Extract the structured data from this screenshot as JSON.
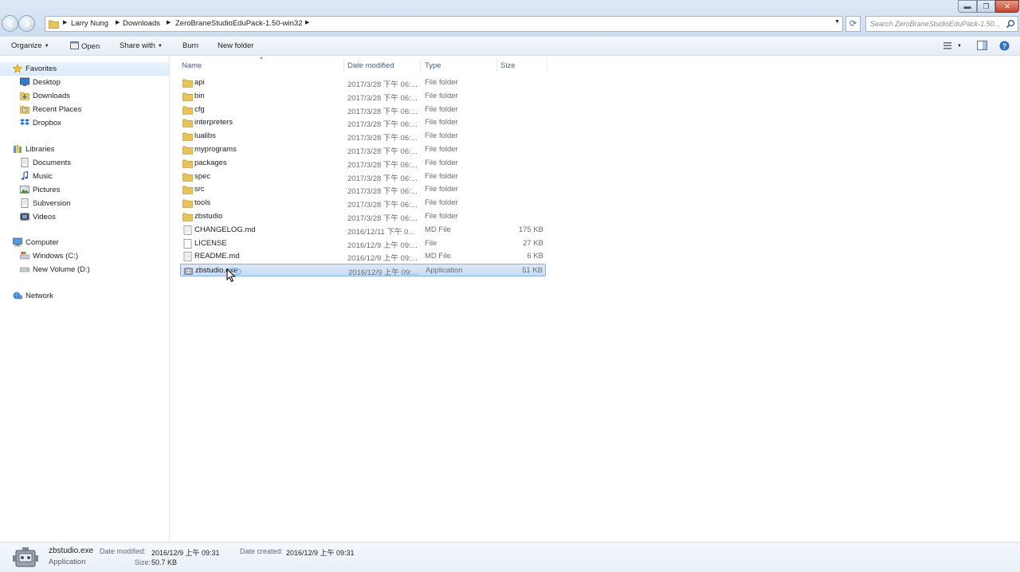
{
  "window": {
    "minimize_glyph": "▬",
    "maximize_glyph": "❐",
    "close_glyph": "✕"
  },
  "address": {
    "breadcrumbs": [
      "Larry Nung",
      "Downloads",
      "ZeroBraneStudioEduPack-1.50-win32"
    ],
    "search_placeholder": "Search ZeroBraneStudioEduPack-1.50..."
  },
  "toolbar": {
    "organize": "Organize",
    "open": "Open",
    "share_with": "Share with",
    "burn": "Burn",
    "new_folder": "New folder"
  },
  "nav": {
    "favorites": {
      "label": "Favorites",
      "items": [
        "Desktop",
        "Downloads",
        "Recent Places",
        "Dropbox"
      ]
    },
    "libraries": {
      "label": "Libraries",
      "items": [
        "Documents",
        "Music",
        "Pictures",
        "Subversion",
        "Videos"
      ]
    },
    "computer": {
      "label": "Computer",
      "items": [
        "Windows  (C:)",
        "New Volume (D:)"
      ]
    },
    "network": {
      "label": "Network"
    }
  },
  "columns": {
    "name": "Name",
    "date_modified": "Date modified",
    "type": "Type",
    "size": "Size"
  },
  "files": [
    {
      "name": "api",
      "date": "2017/3/28 下午 06:...",
      "type": "File folder",
      "size": "",
      "kind": "folder"
    },
    {
      "name": "bin",
      "date": "2017/3/28 下午 06:...",
      "type": "File folder",
      "size": "",
      "kind": "folder"
    },
    {
      "name": "cfg",
      "date": "2017/3/28 下午 06:...",
      "type": "File folder",
      "size": "",
      "kind": "folder"
    },
    {
      "name": "interpreters",
      "date": "2017/3/28 下午 06:...",
      "type": "File folder",
      "size": "",
      "kind": "folder"
    },
    {
      "name": "lualibs",
      "date": "2017/3/28 下午 06:...",
      "type": "File folder",
      "size": "",
      "kind": "folder"
    },
    {
      "name": "myprograms",
      "date": "2017/3/28 下午 06:...",
      "type": "File folder",
      "size": "",
      "kind": "folder"
    },
    {
      "name": "packages",
      "date": "2017/3/28 下午 06:...",
      "type": "File folder",
      "size": "",
      "kind": "folder"
    },
    {
      "name": "spec",
      "date": "2017/3/28 下午 06:...",
      "type": "File folder",
      "size": "",
      "kind": "folder"
    },
    {
      "name": "src",
      "date": "2017/3/28 下午 06:...",
      "type": "File folder",
      "size": "",
      "kind": "folder"
    },
    {
      "name": "tools",
      "date": "2017/3/28 下午 06:...",
      "type": "File folder",
      "size": "",
      "kind": "folder"
    },
    {
      "name": "zbstudio",
      "date": "2017/3/28 下午 06:...",
      "type": "File folder",
      "size": "",
      "kind": "folder"
    },
    {
      "name": "CHANGELOG.md",
      "date": "2016/12/11 下午 0...",
      "type": "MD File",
      "size": "175 KB",
      "kind": "doc"
    },
    {
      "name": "LICENSE",
      "date": "2016/12/9 上午 09:...",
      "type": "File",
      "size": "27 KB",
      "kind": "file"
    },
    {
      "name": "README.md",
      "date": "2016/12/9 上午 09:...",
      "type": "MD File",
      "size": "6 KB",
      "kind": "doc"
    },
    {
      "name": "zbstudio.exe",
      "date": "2016/12/9 上午 09:...",
      "type": "Application",
      "size": "51 KB",
      "kind": "exe",
      "selected": true
    }
  ],
  "details": {
    "name": "zbstudio.exe",
    "type": "Application",
    "date_modified_label": "Date modified:",
    "date_modified": "2016/12/9 上午 09:31",
    "size_label": "Size:",
    "size": "50.7 KB",
    "date_created_label": "Date created:",
    "date_created": "2016/12/9 上午 09:31"
  },
  "colors": {
    "folder": "#e8c25a",
    "selection": "#c6dcf6",
    "accent": "#3a6aa8"
  }
}
